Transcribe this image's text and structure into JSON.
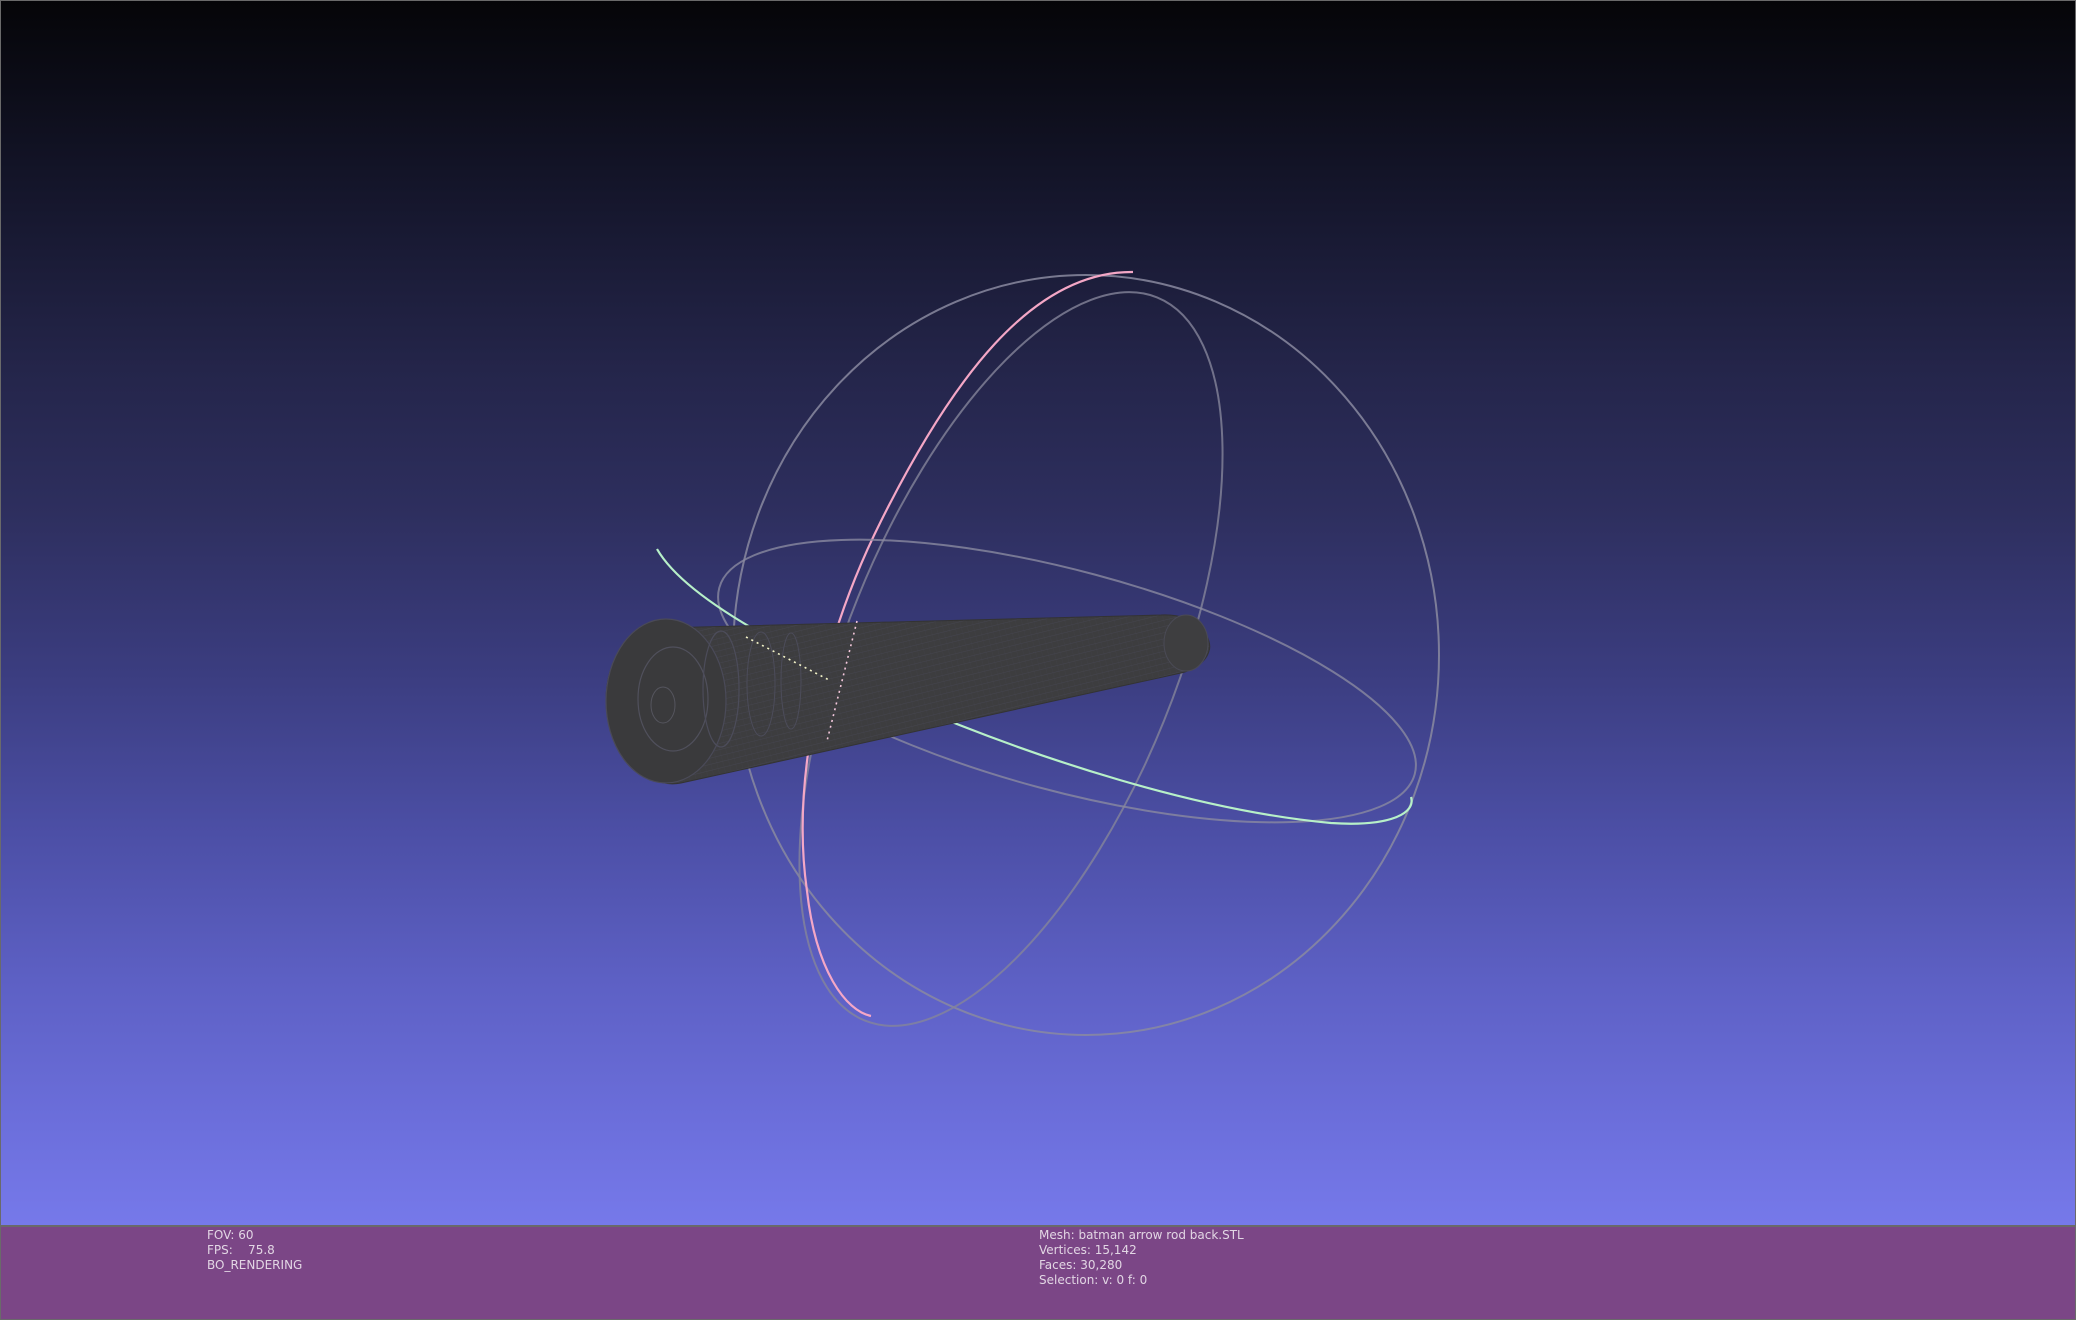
{
  "window": {
    "app": "MeshLab viewer"
  },
  "render_info": {
    "fov": "FOV: 60",
    "fps": "FPS:    75.8",
    "mode": "BO_RENDERING"
  },
  "mesh_info": {
    "mesh": "Mesh: batman arrow rod back.STL",
    "vertices": "Vertices: 15,142",
    "faces": "Faces: 30,280",
    "selection": "Selection: v: 0 f: 0"
  },
  "colors": {
    "background_top": "#050508",
    "background_bottom": "#7679ea",
    "info_bar": "#7b4686",
    "trackball_gray": "#8a8aa0",
    "trackball_pink": "#f4a7c6",
    "trackball_green": "#b7f0c8",
    "mesh": "#3d3d3d"
  }
}
